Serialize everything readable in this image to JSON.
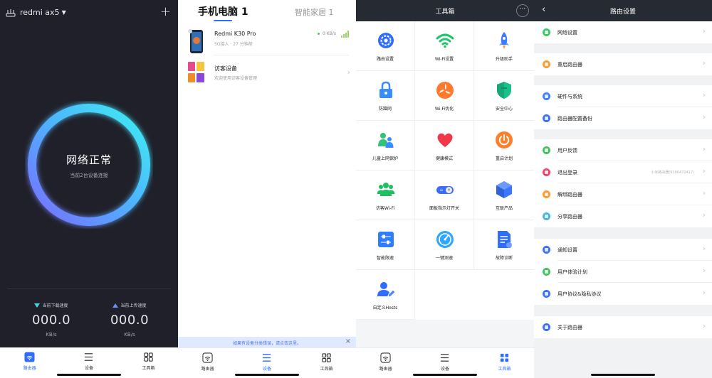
{
  "router_panel": {
    "router_name": "redmi ax5",
    "status": "网络正常",
    "status_sub": "当前2台设备连接",
    "download": {
      "label": "当前下载速度",
      "value": "000.0",
      "unit": "KB/s"
    },
    "upload": {
      "label": "当前上传速度",
      "value": "000.0",
      "unit": "KB/s"
    },
    "colors": {
      "ring_start": "#3ef0f0",
      "ring_end": "#7a6cff",
      "background": "#1f2029"
    }
  },
  "tabbar": {
    "router": "路由器",
    "devices": "设备",
    "toolbox": "工具箱",
    "active_color": "#2f6dff"
  },
  "devices_panel": {
    "tab_active": "手机电脑 1",
    "tab_other": "智能家居 1",
    "devices": [
      {
        "name": "Redmi K30 Pro",
        "meta": "5G接入 · 27 分钟前",
        "speed": "0 KB/s"
      },
      {
        "name": "访客设备",
        "meta": "欢迎使用访客设备管理"
      }
    ],
    "banner": "如果有设备分类错误，请点击这里。"
  },
  "toolbox_panel": {
    "title": "工具箱",
    "tools": [
      {
        "label": "路由设置",
        "icon": "gear-icon",
        "color": "#2f6dff"
      },
      {
        "label": "Wi-Fi设置",
        "icon": "wifi-icon",
        "color": "#1fc46b"
      },
      {
        "label": "升级助手",
        "icon": "rocket-icon",
        "color": "#3d7bff"
      },
      {
        "label": "防蹭网",
        "icon": "lock-icon",
        "color": "#3a8dff"
      },
      {
        "label": "Wi-Fi优化",
        "icon": "fan-icon",
        "color": "#ff7a2e"
      },
      {
        "label": "安全中心",
        "icon": "shield-icon",
        "color": "#19c08a"
      },
      {
        "label": "儿童上网保护",
        "icon": "family-icon",
        "color": "#32c37a"
      },
      {
        "label": "健康模式",
        "icon": "heart-icon",
        "color": "#f0384a"
      },
      {
        "label": "重启计划",
        "icon": "power-icon",
        "color": "#ff7e2a"
      },
      {
        "label": "访客Wi-Fi",
        "icon": "guests-icon",
        "color": "#1fbf62"
      },
      {
        "label": "面板指示灯开关",
        "icon": "toggle-icon",
        "color": "#3a6dff"
      },
      {
        "label": "互联产品",
        "icon": "cube-icon",
        "color": "#3a78ff"
      },
      {
        "label": "智能限速",
        "icon": "sliders-icon",
        "color": "#2f7dff"
      },
      {
        "label": "一键测速",
        "icon": "speedometer-icon",
        "color": "#2fa7ff"
      },
      {
        "label": "故障诊断",
        "icon": "report-icon",
        "color": "#2f6dff"
      },
      {
        "label": "自定义Hosts",
        "icon": "user-edit-icon",
        "color": "#2f6dff"
      }
    ]
  },
  "settings_panel": {
    "title": "路由设置",
    "rows": [
      {
        "label": "网络设置",
        "color": "#3fc764"
      },
      {
        "label": "重启路由器",
        "color": "#ff9a2e"
      },
      {
        "label": "硬件与系统",
        "color": "#3b82ff"
      },
      {
        "label": "路由器配置备份",
        "color": "#3b6fff"
      },
      {
        "label": "用户反馈",
        "color": "#42c45d"
      },
      {
        "label": "退出登录",
        "color": "#f2456a",
        "value": "小米路由器(9386472417)"
      },
      {
        "label": "解绑路由器",
        "color": "#ff9a2e"
      },
      {
        "label": "分享路由器",
        "color": "#3fb6ee"
      },
      {
        "label": "通知设置",
        "color": "#3b6fff"
      },
      {
        "label": "用户体验计划",
        "color": "#42c45d"
      },
      {
        "label": "用户协议&隐私协议",
        "color": "#3b6fff"
      },
      {
        "label": "关于路由器",
        "color": "#3b6fff"
      }
    ]
  }
}
